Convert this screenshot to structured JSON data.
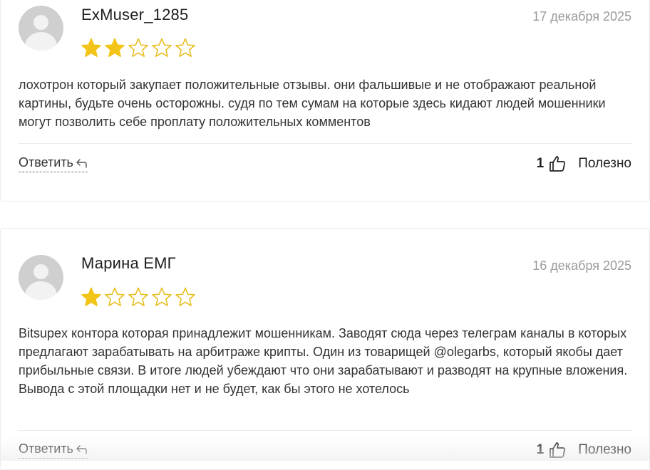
{
  "reviews": [
    {
      "author": "ExMuser_1285",
      "date": "17 декабря 2025",
      "rating": 2,
      "max_rating": 5,
      "text": "лохотрон который закупает положительные отзывы. они фальшивые и не отображают реальной картины, будьте очень осторожны. судя по тем сумам на которые здесь кидают людей мошенники могут позволить себе проплату положительных комментов",
      "reply_label": "Ответить",
      "helpful_count": "1",
      "helpful_label": "Полезно"
    },
    {
      "author": "Марина ЕМГ",
      "date": "16 декабря 2025",
      "rating": 1,
      "max_rating": 5,
      "text": "Bitsupex контора которая принадлежит мошенникам. Заводят сюда через телеграм каналы в которых предлагают зарабатывать на арбитраже крипты. Один из товарищей @olegarbs, который якобы дает прибыльные связи. В итоге людей убеждают что они зарабатывают и разводят на крупные вложения. Вывода с этой площадки нет и не будет, как бы этого не хотелось",
      "reply_label": "Ответить",
      "helpful_count": "1",
      "helpful_label": "Полезно"
    }
  ],
  "colors": {
    "star_filled": "#F2C417",
    "star_empty_outline": "#E8BE22",
    "avatar_bg": "#CFCFCF",
    "date_text": "#9B9B9B"
  },
  "icons": {
    "avatar": "user-avatar-placeholder",
    "star": "star-icon",
    "reply": "reply-arrow-icon",
    "like": "thumbs-up-icon"
  }
}
